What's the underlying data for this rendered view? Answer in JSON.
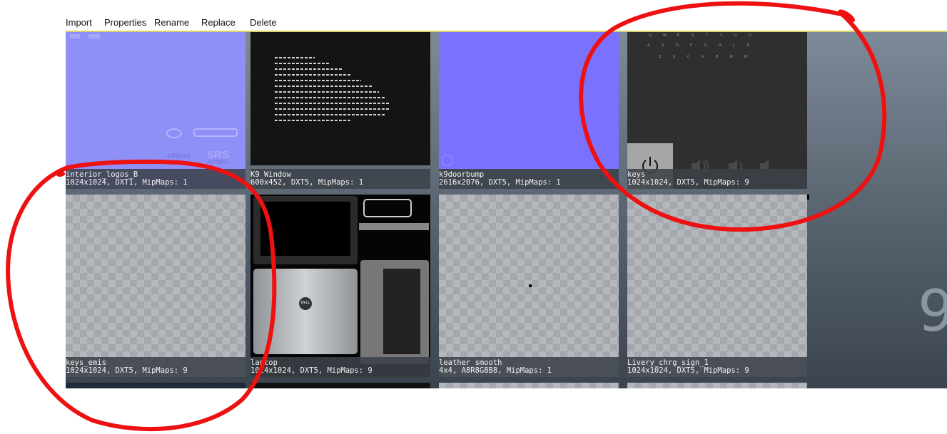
{
  "toolbar": {
    "import": "Import",
    "properties": "Properties",
    "rename": "Rename",
    "replace": "Replace",
    "delete": "Delete"
  },
  "textures": [
    {
      "name": "interior_logos_B",
      "info": "1024x1024, DXT1, MipMaps: 1",
      "thumb_logos": [
        "AIRBAG",
        "SRS",
        "AIRBAG"
      ]
    },
    {
      "name": "K9 Window",
      "info": "600x452, DXT5, MipMaps: 1"
    },
    {
      "name": "k9doorbump",
      "info": "2616x2076, DXT5, MipMaps: 1"
    },
    {
      "name": "keys",
      "info": "1024x1024, DXT5, MipMaps: 9"
    },
    {
      "name": "keys_emis",
      "info": "1024x1024, DXT5, MipMaps: 9"
    },
    {
      "name": "laptop",
      "info": "1024x1024, DXT5, MipMaps: 9",
      "thumb_logo": "DELL"
    },
    {
      "name": "leather smooth",
      "info": "4x4, A8R8G8B8, MipMaps: 1"
    },
    {
      "name": "Livery_chrg_sign_1",
      "info": "1024x1024, DXT5, MipMaps: 9"
    }
  ],
  "colors": {
    "normal_map_blue": "#8f8ff8",
    "annotation_red": "#ee1111",
    "toolbar_underline": "#d9d26a"
  },
  "annotations": [
    "red-circle-keys",
    "red-circle-keys_emis"
  ]
}
